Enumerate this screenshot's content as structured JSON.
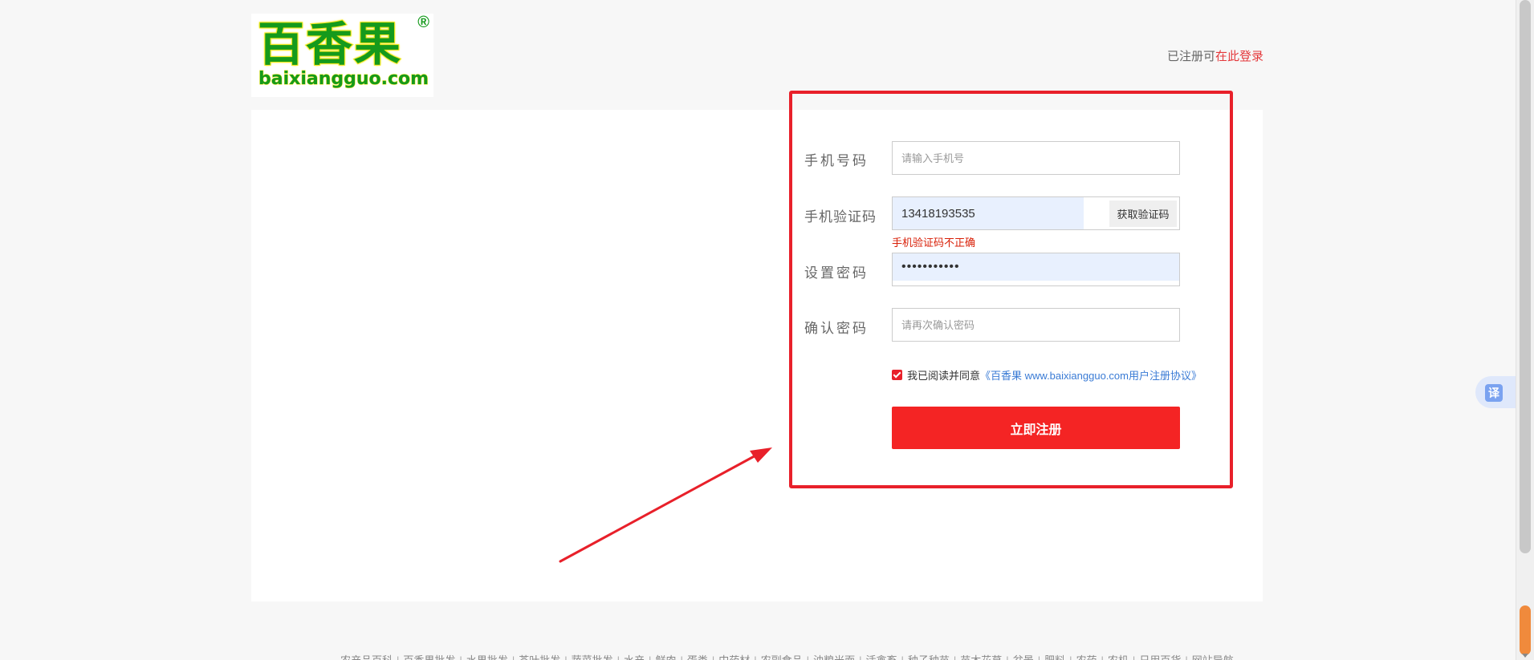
{
  "logo": {
    "cn_text": "百香果",
    "en_text": "baixiangguo.com",
    "reg_mark": "®"
  },
  "header": {
    "login_prefix": "已注册可",
    "login_link": "在此登录"
  },
  "form": {
    "phone_label": "手机号码",
    "phone_placeholder": "请输入手机号",
    "sms_label": "手机验证码",
    "sms_value": "13418193535",
    "sms_button": "获取验证码",
    "sms_error": "手机验证码不正确",
    "password_label": "设置密码",
    "password_value": "•••••••••••",
    "confirm_label": "确认密码",
    "confirm_placeholder": "请再次确认密码",
    "agree_prefix": "我已阅读并同意",
    "agree_link": "《百香果 www.baixiangguo.com用户注册协议》",
    "agree_checked": true,
    "submit_label": "立即注册"
  },
  "footer": {
    "links": [
      "农产品百科",
      "百香果批发",
      "水果批发",
      "茶叶批发",
      "蔬菜批发",
      "水产",
      "鲜肉",
      "蛋类",
      "中药材",
      "农副食品",
      "油粮米面",
      "活禽畜",
      "种子种苗",
      "苗木花草",
      "盆景",
      "肥料",
      "农药",
      "农机",
      "日用百货",
      "网站导航"
    ]
  },
  "translate": {
    "label": "译"
  },
  "colors": {
    "accent_red": "#f42424",
    "highlight_red": "#e8202a",
    "logo_green": "#159a1c",
    "link_blue": "#3a7bd5",
    "autofill_blue": "#e8f0fe"
  }
}
